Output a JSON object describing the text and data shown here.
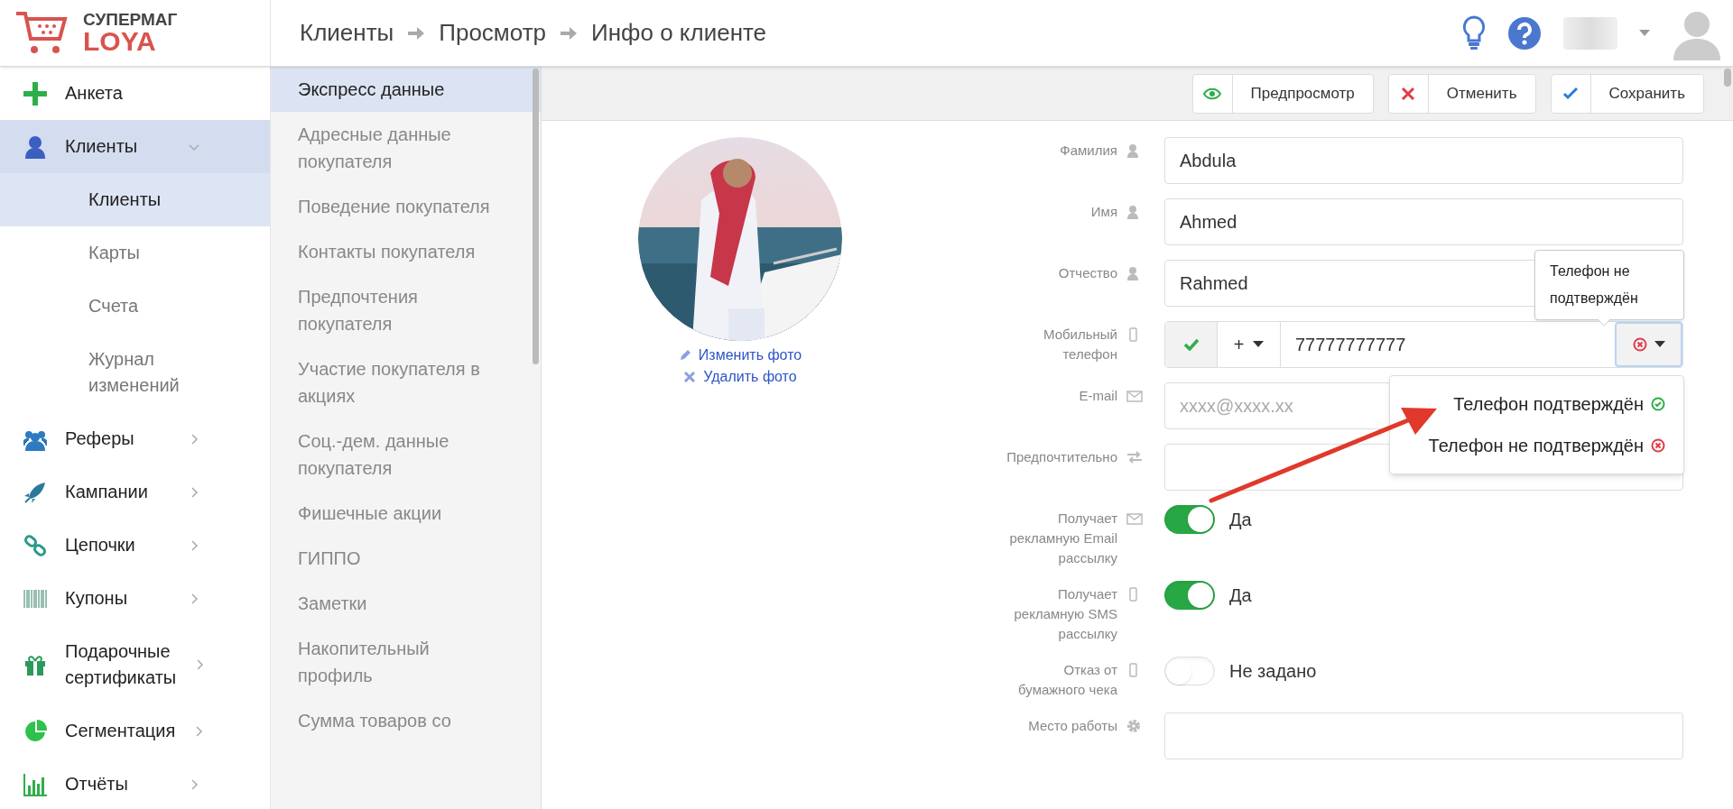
{
  "logo": {
    "line1": "СУПЕРМАГ",
    "line2": "LOYA"
  },
  "breadcrumbs": [
    "Клиенты",
    "Просмотр",
    "Инфо о клиенте"
  ],
  "sidebar": {
    "items": [
      {
        "label": "Анкета",
        "kind": "link",
        "selected": false
      },
      {
        "label": "Клиенты",
        "kind": "group",
        "selected": true,
        "expanded": true,
        "children": [
          {
            "label": "Клиенты",
            "selected": true
          },
          {
            "label": "Карты",
            "selected": false
          },
          {
            "label": "Счета",
            "selected": false
          },
          {
            "label": "Журнал изменений",
            "selected": false
          }
        ]
      },
      {
        "label": "Реферы",
        "kind": "group",
        "selected": false,
        "expanded": false
      },
      {
        "label": "Кампании",
        "kind": "group",
        "selected": false,
        "expanded": false
      },
      {
        "label": "Цепочки",
        "kind": "group",
        "selected": false,
        "expanded": false
      },
      {
        "label": "Купоны",
        "kind": "group",
        "selected": false,
        "expanded": false
      },
      {
        "label": "Подарочные сертификаты",
        "kind": "group",
        "selected": false,
        "expanded": false
      },
      {
        "label": "Сегментация",
        "kind": "group",
        "selected": false,
        "expanded": false
      },
      {
        "label": "Отчёты",
        "kind": "group",
        "selected": false,
        "expanded": false
      }
    ]
  },
  "sections": [
    {
      "label": "Экспресс данные",
      "selected": true
    },
    {
      "label": "Адресные данные покупателя",
      "selected": false
    },
    {
      "label": "Поведение покупателя",
      "selected": false
    },
    {
      "label": "Контакты покупателя",
      "selected": false
    },
    {
      "label": "Предпочтения покупателя",
      "selected": false
    },
    {
      "label": "Участие покупателя в акциях",
      "selected": false
    },
    {
      "label": "Соц.-дем. данные покупателя",
      "selected": false
    },
    {
      "label": "Фишечные акции",
      "selected": false
    },
    {
      "label": "ГИППО",
      "selected": false
    },
    {
      "label": "Заметки",
      "selected": false
    },
    {
      "label": "Накопительный профиль",
      "selected": false
    },
    {
      "label": "Сумма товаров со",
      "selected": false
    }
  ],
  "toolbar": [
    {
      "label": "Предпросмотр",
      "kind": "preview"
    },
    {
      "label": "Отменить",
      "kind": "cancel"
    },
    {
      "label": "Сохранить",
      "kind": "save"
    }
  ],
  "photo_links": [
    {
      "label": "Изменить фото",
      "kind": "edit"
    },
    {
      "label": "Удалить фото",
      "kind": "delete"
    }
  ],
  "form": [
    {
      "kind": "text",
      "label": "Фамилия",
      "value": "Abdula"
    },
    {
      "kind": "text",
      "label": "Имя",
      "value": "Ahmed"
    },
    {
      "kind": "text",
      "label": "Отчество",
      "value": "Rahmed"
    },
    {
      "kind": "phone",
      "label": "Мобильный телефон",
      "prefix": "+",
      "value": "77777777777",
      "verified": false
    },
    {
      "kind": "text",
      "label": "E-mail",
      "placeholder": "xxxx@xxxx.xx"
    },
    {
      "kind": "text",
      "label": "Предпочтительно"
    },
    {
      "kind": "toggle",
      "label": "Получает рекламную Email рассылку",
      "on": true,
      "text": "Да"
    },
    {
      "kind": "toggle",
      "label": "Получает рекламную SMS рассылку",
      "on": true,
      "text": "Да"
    },
    {
      "kind": "toggle",
      "label": "Отказ от бумажного чека",
      "on": false,
      "text": "Не задано"
    },
    {
      "kind": "text",
      "label": "Место работы"
    }
  ],
  "tooltip": "Телефон не подтверждён",
  "status_menu": [
    {
      "label": "Телефон подтверждён",
      "kind": "confirmed"
    },
    {
      "label": "Телефон не подтверждён",
      "kind": "unconfirmed"
    }
  ]
}
